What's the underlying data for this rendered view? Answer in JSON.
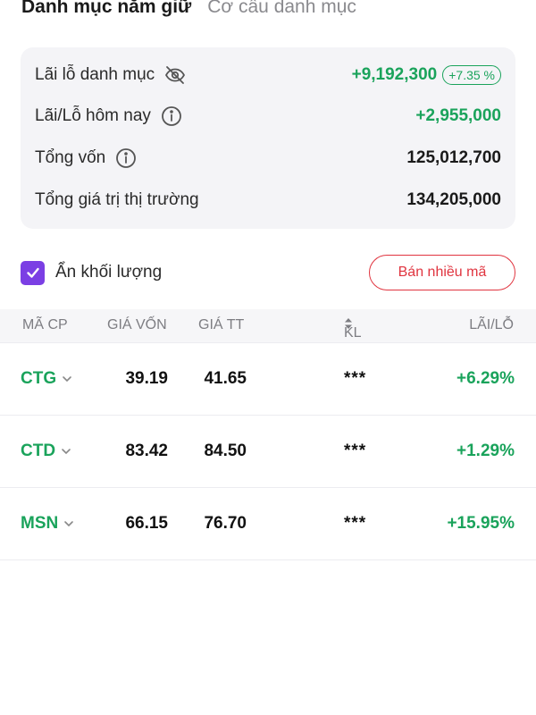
{
  "tabs": [
    {
      "label": "Danh mục nắm giữ",
      "active": true
    },
    {
      "label": "Cơ cấu danh mục",
      "active": false
    }
  ],
  "summary": {
    "pnl_label": "Lãi lỗ danh mục",
    "pnl_value": "+9,192,300",
    "pnl_percent": "+7.35 %",
    "today_label": "Lãi/Lỗ hôm nay",
    "today_value": "+2,955,000",
    "capital_label": "Tổng vốn",
    "capital_value": "125,012,700",
    "market_label": "Tổng giá trị thị trường",
    "market_value": "134,205,000"
  },
  "options": {
    "hide_volume_label": "Ẩn khối lượng",
    "hide_volume_checked": true,
    "sell_many_label": "Bán nhiều mã"
  },
  "table": {
    "headers": {
      "code": "MÃ CP",
      "cost": "GIÁ VỐN",
      "market": "GIÁ TT",
      "volume": "KL",
      "pnl": "LÃI/LỖ"
    },
    "rows": [
      {
        "code": "CTG",
        "cost": "39.19",
        "market": "41.65",
        "volume": "***",
        "pnl": "+6.29%"
      },
      {
        "code": "CTD",
        "cost": "83.42",
        "market": "84.50",
        "volume": "***",
        "pnl": "+1.29%"
      },
      {
        "code": "MSN",
        "cost": "66.15",
        "market": "76.70",
        "volume": "***",
        "pnl": "+15.95%"
      }
    ]
  },
  "colors": {
    "positive": "#1aa35b",
    "accent_purple": "#7b3fe4",
    "sell_red": "#e0343f"
  },
  "icons": {
    "hide": "eye-off-icon",
    "info": "info-icon",
    "check": "check-icon",
    "chevron": "chevron-down-icon",
    "sort": "sort-icon"
  }
}
